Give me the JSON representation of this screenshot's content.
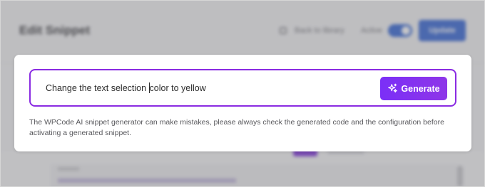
{
  "background_page": {
    "title": "Edit Snippet",
    "library_link": "Back to library",
    "status_label": "Active",
    "update_button": "Update"
  },
  "ai_modal": {
    "prompt_value": "Change the text selection color to yellow",
    "prompt_before_caret": "Change the text selection ",
    "prompt_after_caret": "color to yellow",
    "generate_label": "Generate",
    "generate_icon": "sparkles-icon",
    "disclaimer": "The WPCode AI snippet generator can make mistakes, please always check the generated code and the configuration before activating a generated snippet."
  },
  "colors": {
    "accent": "#8a2be2",
    "button": "#7b2ff7",
    "update": "#2c5fd3"
  }
}
